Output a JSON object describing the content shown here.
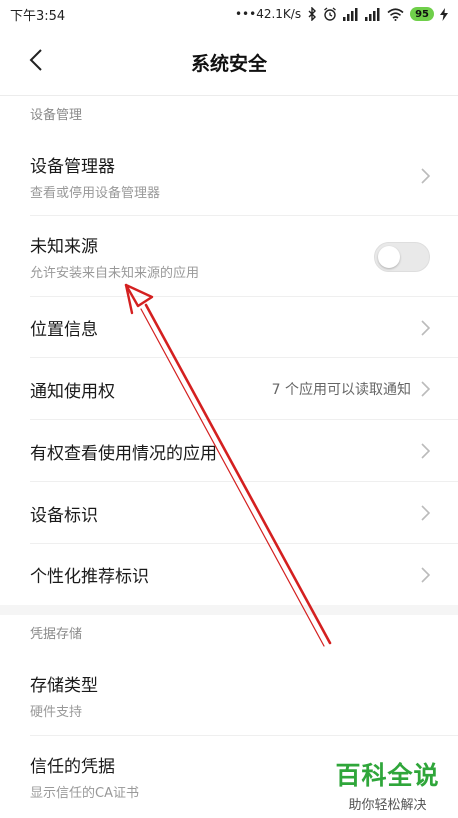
{
  "status_bar": {
    "time": "下午3:54",
    "network_speed": "•••42.1K/s",
    "battery_level": "95",
    "icons": [
      "bluetooth-icon",
      "alarm-icon",
      "signal-icon",
      "signal-icon",
      "wifi-icon",
      "battery-icon",
      "charging-icon"
    ]
  },
  "header": {
    "title": "系统安全",
    "back_icon": "chevron-left-icon"
  },
  "sections": [
    {
      "header": "设备管理",
      "items": [
        {
          "title": "设备管理器",
          "subtitle": "查看或停用设备管理器",
          "control": "chevron"
        },
        {
          "title": "未知来源",
          "subtitle": "允许安装来自未知来源的应用",
          "control": "toggle",
          "toggle_on": false
        },
        {
          "title": "位置信息",
          "control": "chevron"
        },
        {
          "title": "通知使用权",
          "value": "7 个应用可以读取通知",
          "control": "chevron"
        },
        {
          "title": "有权查看使用情况的应用",
          "control": "chevron"
        },
        {
          "title": "设备标识",
          "control": "chevron"
        },
        {
          "title": "个性化推荐标识",
          "control": "chevron"
        }
      ]
    },
    {
      "header": "凭据存储",
      "items": [
        {
          "title": "存储类型",
          "subtitle": "硬件支持"
        },
        {
          "title": "信任的凭据",
          "subtitle": "显示信任的CA证书"
        }
      ]
    }
  ],
  "watermark": {
    "main": "百科全说",
    "sub": "助你轻松解决"
  },
  "colors": {
    "annotation_arrow": "#d42020",
    "watermark_green": "#2fa63a",
    "battery_green": "#6fcf4a"
  }
}
